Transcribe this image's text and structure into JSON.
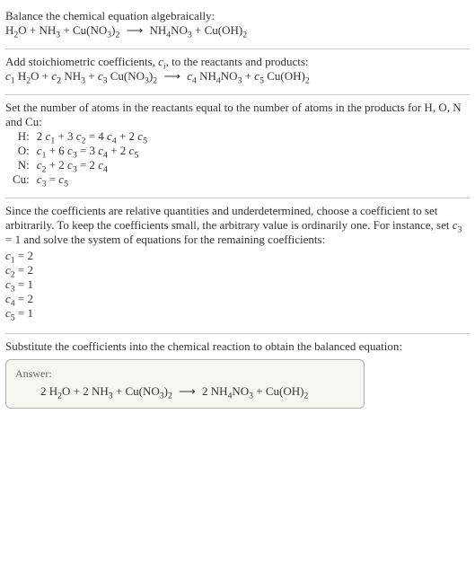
{
  "intro": {
    "line1": "Balance the chemical equation algebraically:",
    "eq_lhs": "H<sub>2</sub>O + NH<sub>3</sub> + Cu(NO<sub>3</sub>)<sub>2</sub>",
    "arrow": "⟶",
    "eq_rhs": "NH<sub>4</sub>NO<sub>3</sub> + Cu(OH)<sub>2</sub>"
  },
  "stoich": {
    "text": "Add stoichiometric coefficients, <span class='ital'>c<sub>i</sub></span>, to the reactants and products:",
    "eq_lhs": "<span class='ital'>c</span><sub>1</sub> H<sub>2</sub>O + <span class='ital'>c</span><sub>2</sub> NH<sub>3</sub> + <span class='ital'>c</span><sub>3</sub> Cu(NO<sub>3</sub>)<sub>2</sub>",
    "arrow": "⟶",
    "eq_rhs": "<span class='ital'>c</span><sub>4</sub> NH<sub>4</sub>NO<sub>3</sub> + <span class='ital'>c</span><sub>5</sub> Cu(OH)<sub>2</sub>"
  },
  "atoms": {
    "text": "Set the number of atoms in the reactants equal to the number of atoms in the products for H, O, N and Cu:",
    "rows": [
      {
        "el": "H:",
        "eq": "2 <span class='ital'>c</span><sub>1</sub> + 3 <span class='ital'>c</span><sub>2</sub> = 4 <span class='ital'>c</span><sub>4</sub> + 2 <span class='ital'>c</span><sub>5</sub>"
      },
      {
        "el": "O:",
        "eq": "<span class='ital'>c</span><sub>1</sub> + 6 <span class='ital'>c</span><sub>3</sub> = 3 <span class='ital'>c</span><sub>4</sub> + 2 <span class='ital'>c</span><sub>5</sub>"
      },
      {
        "el": "N:",
        "eq": "<span class='ital'>c</span><sub>2</sub> + 2 <span class='ital'>c</span><sub>3</sub> = 2 <span class='ital'>c</span><sub>4</sub>"
      },
      {
        "el": "Cu:",
        "eq": "<span class='ital'>c</span><sub>3</sub> = <span class='ital'>c</span><sub>5</sub>"
      }
    ]
  },
  "solve": {
    "text": "Since the coefficients are relative quantities and underdetermined, choose a coefficient to set arbitrarily. To keep the coefficients small, the arbitrary value is ordinarily one. For instance, set <span class='ital'>c</span><sub>3</sub> = 1 and solve the system of equations for the remaining coefficients:",
    "coefs": [
      "<span class='ital'>c</span><sub>1</sub> = 2",
      "<span class='ital'>c</span><sub>2</sub> = 2",
      "<span class='ital'>c</span><sub>3</sub> = 1",
      "<span class='ital'>c</span><sub>4</sub> = 2",
      "<span class='ital'>c</span><sub>5</sub> = 1"
    ]
  },
  "substitute": {
    "text": "Substitute the coefficients into the chemical reaction to obtain the balanced equation:"
  },
  "answer": {
    "label": "Answer:",
    "eq_lhs": "2 H<sub>2</sub>O + 2 NH<sub>3</sub> + Cu(NO<sub>3</sub>)<sub>2</sub>",
    "arrow": "⟶",
    "eq_rhs": "2 NH<sub>4</sub>NO<sub>3</sub> + Cu(OH)<sub>2</sub>"
  }
}
